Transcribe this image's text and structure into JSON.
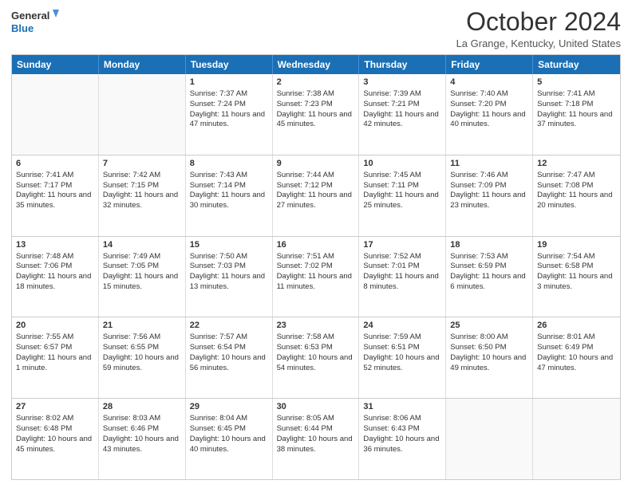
{
  "header": {
    "logo_line1": "General",
    "logo_line2": "Blue",
    "month": "October 2024",
    "location": "La Grange, Kentucky, United States"
  },
  "days_of_week": [
    "Sunday",
    "Monday",
    "Tuesday",
    "Wednesday",
    "Thursday",
    "Friday",
    "Saturday"
  ],
  "weeks": [
    [
      {
        "day": "",
        "sunrise": "",
        "sunset": "",
        "daylight": ""
      },
      {
        "day": "",
        "sunrise": "",
        "sunset": "",
        "daylight": ""
      },
      {
        "day": "1",
        "sunrise": "Sunrise: 7:37 AM",
        "sunset": "Sunset: 7:24 PM",
        "daylight": "Daylight: 11 hours and 47 minutes."
      },
      {
        "day": "2",
        "sunrise": "Sunrise: 7:38 AM",
        "sunset": "Sunset: 7:23 PM",
        "daylight": "Daylight: 11 hours and 45 minutes."
      },
      {
        "day": "3",
        "sunrise": "Sunrise: 7:39 AM",
        "sunset": "Sunset: 7:21 PM",
        "daylight": "Daylight: 11 hours and 42 minutes."
      },
      {
        "day": "4",
        "sunrise": "Sunrise: 7:40 AM",
        "sunset": "Sunset: 7:20 PM",
        "daylight": "Daylight: 11 hours and 40 minutes."
      },
      {
        "day": "5",
        "sunrise": "Sunrise: 7:41 AM",
        "sunset": "Sunset: 7:18 PM",
        "daylight": "Daylight: 11 hours and 37 minutes."
      }
    ],
    [
      {
        "day": "6",
        "sunrise": "Sunrise: 7:41 AM",
        "sunset": "Sunset: 7:17 PM",
        "daylight": "Daylight: 11 hours and 35 minutes."
      },
      {
        "day": "7",
        "sunrise": "Sunrise: 7:42 AM",
        "sunset": "Sunset: 7:15 PM",
        "daylight": "Daylight: 11 hours and 32 minutes."
      },
      {
        "day": "8",
        "sunrise": "Sunrise: 7:43 AM",
        "sunset": "Sunset: 7:14 PM",
        "daylight": "Daylight: 11 hours and 30 minutes."
      },
      {
        "day": "9",
        "sunrise": "Sunrise: 7:44 AM",
        "sunset": "Sunset: 7:12 PM",
        "daylight": "Daylight: 11 hours and 27 minutes."
      },
      {
        "day": "10",
        "sunrise": "Sunrise: 7:45 AM",
        "sunset": "Sunset: 7:11 PM",
        "daylight": "Daylight: 11 hours and 25 minutes."
      },
      {
        "day": "11",
        "sunrise": "Sunrise: 7:46 AM",
        "sunset": "Sunset: 7:09 PM",
        "daylight": "Daylight: 11 hours and 23 minutes."
      },
      {
        "day": "12",
        "sunrise": "Sunrise: 7:47 AM",
        "sunset": "Sunset: 7:08 PM",
        "daylight": "Daylight: 11 hours and 20 minutes."
      }
    ],
    [
      {
        "day": "13",
        "sunrise": "Sunrise: 7:48 AM",
        "sunset": "Sunset: 7:06 PM",
        "daylight": "Daylight: 11 hours and 18 minutes."
      },
      {
        "day": "14",
        "sunrise": "Sunrise: 7:49 AM",
        "sunset": "Sunset: 7:05 PM",
        "daylight": "Daylight: 11 hours and 15 minutes."
      },
      {
        "day": "15",
        "sunrise": "Sunrise: 7:50 AM",
        "sunset": "Sunset: 7:03 PM",
        "daylight": "Daylight: 11 hours and 13 minutes."
      },
      {
        "day": "16",
        "sunrise": "Sunrise: 7:51 AM",
        "sunset": "Sunset: 7:02 PM",
        "daylight": "Daylight: 11 hours and 11 minutes."
      },
      {
        "day": "17",
        "sunrise": "Sunrise: 7:52 AM",
        "sunset": "Sunset: 7:01 PM",
        "daylight": "Daylight: 11 hours and 8 minutes."
      },
      {
        "day": "18",
        "sunrise": "Sunrise: 7:53 AM",
        "sunset": "Sunset: 6:59 PM",
        "daylight": "Daylight: 11 hours and 6 minutes."
      },
      {
        "day": "19",
        "sunrise": "Sunrise: 7:54 AM",
        "sunset": "Sunset: 6:58 PM",
        "daylight": "Daylight: 11 hours and 3 minutes."
      }
    ],
    [
      {
        "day": "20",
        "sunrise": "Sunrise: 7:55 AM",
        "sunset": "Sunset: 6:57 PM",
        "daylight": "Daylight: 11 hours and 1 minute."
      },
      {
        "day": "21",
        "sunrise": "Sunrise: 7:56 AM",
        "sunset": "Sunset: 6:55 PM",
        "daylight": "Daylight: 10 hours and 59 minutes."
      },
      {
        "day": "22",
        "sunrise": "Sunrise: 7:57 AM",
        "sunset": "Sunset: 6:54 PM",
        "daylight": "Daylight: 10 hours and 56 minutes."
      },
      {
        "day": "23",
        "sunrise": "Sunrise: 7:58 AM",
        "sunset": "Sunset: 6:53 PM",
        "daylight": "Daylight: 10 hours and 54 minutes."
      },
      {
        "day": "24",
        "sunrise": "Sunrise: 7:59 AM",
        "sunset": "Sunset: 6:51 PM",
        "daylight": "Daylight: 10 hours and 52 minutes."
      },
      {
        "day": "25",
        "sunrise": "Sunrise: 8:00 AM",
        "sunset": "Sunset: 6:50 PM",
        "daylight": "Daylight: 10 hours and 49 minutes."
      },
      {
        "day": "26",
        "sunrise": "Sunrise: 8:01 AM",
        "sunset": "Sunset: 6:49 PM",
        "daylight": "Daylight: 10 hours and 47 minutes."
      }
    ],
    [
      {
        "day": "27",
        "sunrise": "Sunrise: 8:02 AM",
        "sunset": "Sunset: 6:48 PM",
        "daylight": "Daylight: 10 hours and 45 minutes."
      },
      {
        "day": "28",
        "sunrise": "Sunrise: 8:03 AM",
        "sunset": "Sunset: 6:46 PM",
        "daylight": "Daylight: 10 hours and 43 minutes."
      },
      {
        "day": "29",
        "sunrise": "Sunrise: 8:04 AM",
        "sunset": "Sunset: 6:45 PM",
        "daylight": "Daylight: 10 hours and 40 minutes."
      },
      {
        "day": "30",
        "sunrise": "Sunrise: 8:05 AM",
        "sunset": "Sunset: 6:44 PM",
        "daylight": "Daylight: 10 hours and 38 minutes."
      },
      {
        "day": "31",
        "sunrise": "Sunrise: 8:06 AM",
        "sunset": "Sunset: 6:43 PM",
        "daylight": "Daylight: 10 hours and 36 minutes."
      },
      {
        "day": "",
        "sunrise": "",
        "sunset": "",
        "daylight": ""
      },
      {
        "day": "",
        "sunrise": "",
        "sunset": "",
        "daylight": ""
      }
    ]
  ]
}
